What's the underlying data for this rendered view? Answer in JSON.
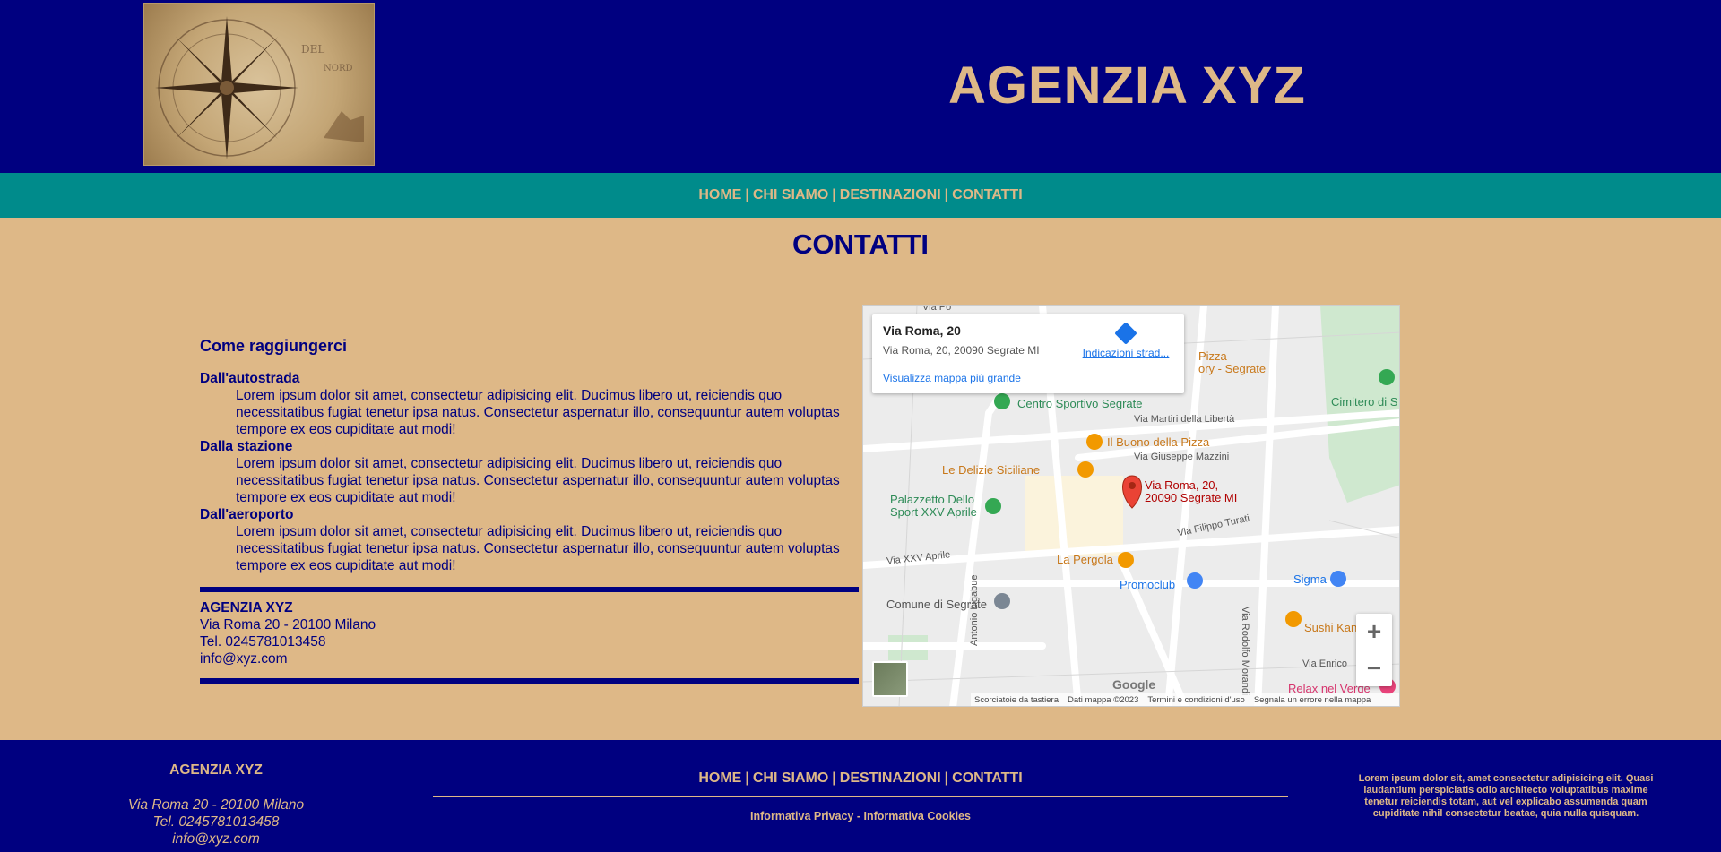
{
  "header": {
    "title": "AGENZIA XYZ",
    "logo_icon": "compass-rose-icon"
  },
  "nav": {
    "items": [
      "HOME",
      "CHI SIAMO",
      "DESTINAZIONI",
      "CONTATTI"
    ],
    "separator": "|"
  },
  "main": {
    "page_title": "CONTATTI",
    "section_heading": "Come raggiungerci",
    "directions": [
      {
        "term": "Dall'autostrada",
        "text": "Lorem ipsum dolor sit amet, consectetur adipisicing elit. Ducimus libero ut, reiciendis quo necessitatibus fugiat tenetur ipsa natus. Consectetur aspernatur illo, consequuntur autem voluptas tempore ex eos cupiditate aut modi!"
      },
      {
        "term": "Dalla stazione",
        "text": "Lorem ipsum dolor sit amet, consectetur adipisicing elit. Ducimus libero ut, reiciendis quo necessitatibus fugiat tenetur ipsa natus. Consectetur aspernatur illo, consequuntur autem voluptas tempore ex eos cupiditate aut modi!"
      },
      {
        "term": "Dall'aeroporto",
        "text": "Lorem ipsum dolor sit amet, consectetur adipisicing elit. Ducimus libero ut, reiciendis quo necessitatibus fugiat tenetur ipsa natus. Consectetur aspernatur illo, consequuntur autem voluptas tempore ex eos cupiditate aut modi!"
      }
    ],
    "address": {
      "name": "AGENZIA XYZ",
      "street": "Via Roma 20 - 20100 Milano",
      "phone": "Tel. 0245781013458",
      "email": "info@xyz.com"
    }
  },
  "map": {
    "place_name": "Via Roma, 20",
    "place_address": "Via Roma, 20, 20090 Segrate MI",
    "directions_label": "Indicazioni strad...",
    "larger_map_label": "Visualizza mappa più grande",
    "pin_label_line1": "Via Roma, 20,",
    "pin_label_line2": "20090 Segrate MI",
    "zoom_in": "+",
    "zoom_out": "−",
    "google": "Google",
    "footer": [
      "Scorciatoie da tastiera",
      "Dati mappa ©2023",
      "Termini e condizioni d'uso",
      "Segnala un errore nella mappa"
    ],
    "labels": {
      "via_po": "Via Po",
      "pizza_factory": "Pizza\nory - Segrate",
      "centro_sportivo": "Centro Sportivo Segrate",
      "cimitero": "Cimitero di S",
      "via_martiri": "Via Martiri della Libertà",
      "buono_pizza": "Il Buono della Pizza",
      "via_mazzini": "Via Giuseppe Mazzini",
      "delizie": "Le Delizie Siciliane",
      "palazzetto": "Palazzetto Dello\nSport XXV Aprile",
      "via_turati": "Via Filippo Turati",
      "via_xxv": "Via XXV Aprile",
      "pergola": "La Pergola",
      "promoclub": "Promoclub",
      "sigma": "Sigma",
      "comune": "Comune di Segrate",
      "sushi": "Sushi Kan",
      "via_enrico": "Via Enrico",
      "relax": "Relax nel Verde",
      "via_ligabue": "Antonio Ligabue",
      "via_morandi": "Via Rodolfo Morandi"
    }
  },
  "footer": {
    "name": "AGENZIA XYZ",
    "street": "Via Roma 20 - 20100 Milano",
    "phone": "Tel. 0245781013458",
    "email": "info@xyz.com",
    "legal": "Informativa Privacy - Informativa Cookies",
    "blurb": "Lorem ipsum dolor sit, amet consectetur adipisicing elit. Quasi laudantium perspiciatis odio architecto voluptatibus maxime tenetur reiciendis totam, aut vel explicabo assumenda quam cupiditate nihil consectetur beatae, quia nulla quisquam."
  },
  "colors": {
    "navy": "#000080",
    "teal": "#008b8b",
    "tan": "#deb887"
  }
}
